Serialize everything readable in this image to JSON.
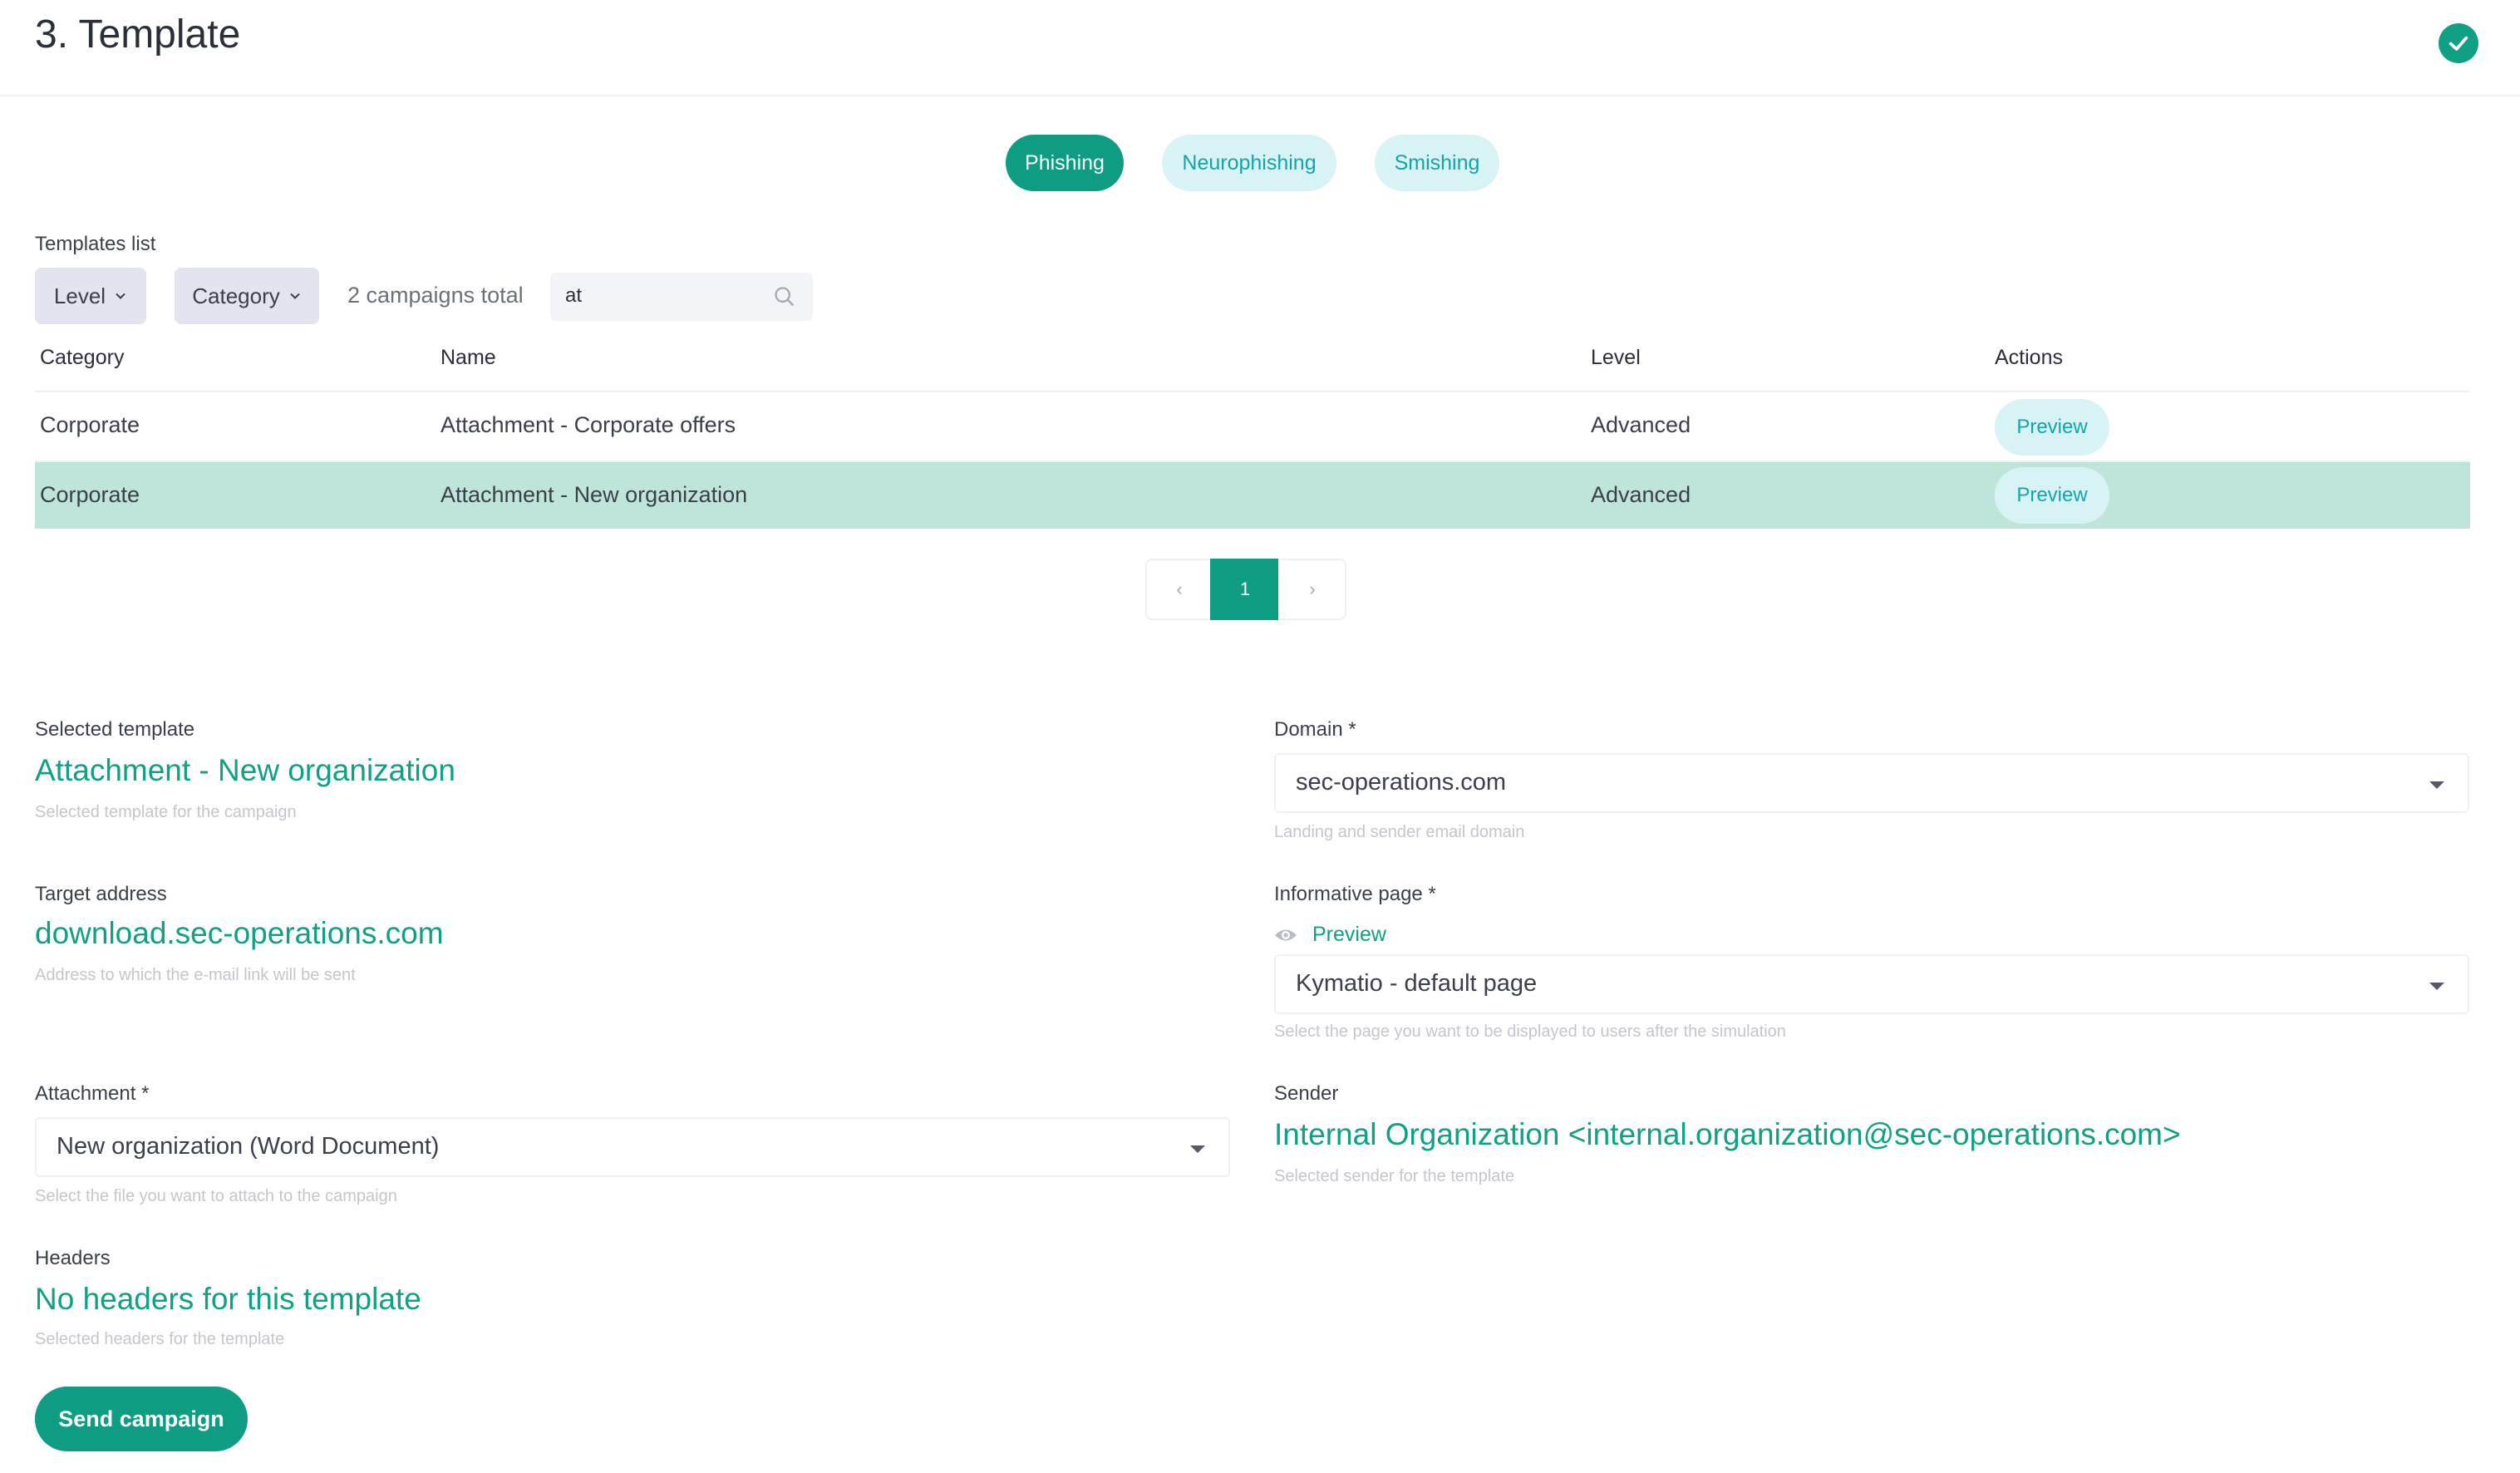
{
  "header": {
    "title": "3. Template"
  },
  "type_tabs": [
    {
      "label": "Phishing",
      "active": true
    },
    {
      "label": "Neurophishing",
      "active": false
    },
    {
      "label": "Smishing",
      "active": false
    }
  ],
  "templates": {
    "label": "Templates list",
    "filters": {
      "level": "Level",
      "category": "Category"
    },
    "total": "2 campaigns total",
    "search": {
      "value": "at"
    },
    "columns": {
      "category": "Category",
      "name": "Name",
      "level": "Level",
      "actions": "Actions"
    },
    "rows": [
      {
        "category": "Corporate",
        "name": "Attachment - Corporate offers",
        "level": "Advanced",
        "action": "Preview",
        "selected": false
      },
      {
        "category": "Corporate",
        "name": "Attachment - New organization",
        "level": "Advanced",
        "action": "Preview",
        "selected": true
      }
    ],
    "pagination": {
      "prev": "‹",
      "current": "1",
      "next": "›"
    }
  },
  "selected_template": {
    "label": "Selected template",
    "value": "Attachment - New organization",
    "hint": "Selected template for the campaign"
  },
  "target_address": {
    "label": "Target address",
    "value": "download.sec-operations.com",
    "hint": "Address to which the e-mail link will be sent"
  },
  "attachment": {
    "label": "Attachment *",
    "value": "New organization (Word Document)",
    "hint": "Select the file you want to attach to the campaign"
  },
  "headers": {
    "label": "Headers",
    "value": "No headers for this template",
    "hint": "Selected headers for the template"
  },
  "domain": {
    "label": "Domain *",
    "value": "sec-operations.com",
    "hint": "Landing and sender email domain"
  },
  "informative_page": {
    "label": "Informative page *",
    "preview": "Preview",
    "value": "Kymatio - default page",
    "hint": "Select the page you want to be displayed to users after the simulation"
  },
  "sender": {
    "label": "Sender",
    "value": "Internal Organization <internal.organization@sec-operations.com>",
    "hint": "Selected sender for the template"
  },
  "actions": {
    "send": "Send campaign"
  },
  "colors": {
    "accent": "#0e9c82",
    "accent_light": "#d8f3f5",
    "selected_row": "#bfe4d9"
  }
}
